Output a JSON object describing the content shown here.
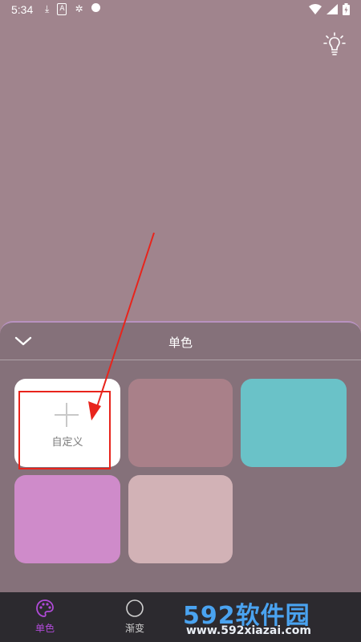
{
  "status": {
    "time": "5:34",
    "left_icons": [
      "download-icon",
      "a-icon",
      "bug-icon",
      "chat-icon"
    ],
    "right_icons": [
      "wifi-icon",
      "signal-icon",
      "battery-icon"
    ]
  },
  "background_color": "#a0848d",
  "sheet": {
    "title": "单色",
    "custom_label": "自定义",
    "swatches": [
      {
        "color": "#ffffff",
        "kind": "custom"
      },
      {
        "color": "#a98089"
      },
      {
        "color": "#6ac2c8"
      },
      {
        "color": "#cf8bca"
      },
      {
        "color": "#d2b2b6"
      }
    ]
  },
  "nav": {
    "items": [
      {
        "label": "单色",
        "active": true,
        "color": "#b04ad8"
      },
      {
        "label": "渐变",
        "active": false,
        "color": "#cfcfcf"
      }
    ]
  },
  "watermark": {
    "main": "592软件园",
    "sub": "www.592xiazai.com"
  },
  "annotation": {
    "color": "#e8241c"
  }
}
